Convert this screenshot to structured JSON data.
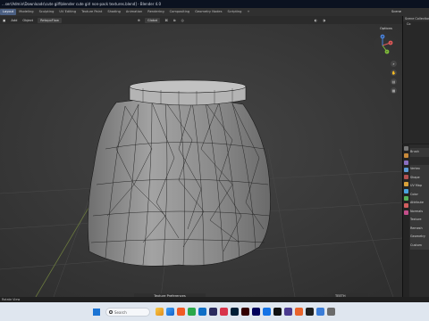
{
  "window": {
    "title": "...ser\\Admin\\Downloads\\cute gilf\\blender cute girl non-pack textures.blend] - Blender 4.0"
  },
  "topbar": {
    "menus": [],
    "tabs": [
      "Layout",
      "Modeling",
      "Sculpting",
      "UV Editing",
      "Texture Paint",
      "Shading",
      "Animation",
      "Rendering",
      "Compositing",
      "Geometry Nodes",
      "Scripting"
    ],
    "active_tab": "Layout",
    "add_tab": "+",
    "scene_label": "Scene"
  },
  "toolbar": {
    "add": "Add",
    "object": "Object",
    "retopoflow": "RetopoFlow",
    "transform_orientation": "Global",
    "options": "Options"
  },
  "navigation": {
    "x_axis": "X",
    "y_axis": "Y",
    "z_axis": "Z"
  },
  "outliner": {
    "header": "Scene Collection",
    "rows": [
      "Co",
      "",
      "",
      ""
    ]
  },
  "properties": {
    "rows": [
      "Brush",
      "",
      "Vertex",
      "Shape",
      "UV Map",
      "Color",
      "Attribute",
      "Normals",
      "Texture",
      "Remesh",
      "Geometry",
      "Custom"
    ]
  },
  "viewport_footer": {
    "label": "Texture Preferences",
    "search": "TEETH"
  },
  "status_bar": {
    "left": "Rotate View"
  },
  "taskbar": {
    "search_placeholder": "Search",
    "weather": "",
    "time": "",
    "date": ""
  },
  "colors": {
    "accent": "#4b5f82",
    "mesh": "#8a8a8a",
    "viewport_bg": "#3c3c3c"
  }
}
